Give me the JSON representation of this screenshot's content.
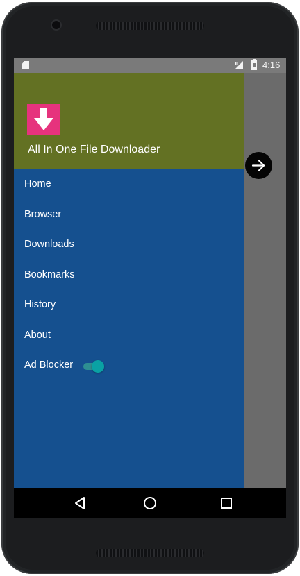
{
  "status_bar": {
    "time": "4:16",
    "icons": [
      "sd-card-icon",
      "signal-icon",
      "battery-icon"
    ]
  },
  "drawer": {
    "header": {
      "app_title": "All In One File Downloader",
      "logo_icon": "download-arrow-icon",
      "colors": {
        "header_bg": "#637123",
        "logo_bg": "#e6337d"
      }
    },
    "items": [
      {
        "label": "Home"
      },
      {
        "label": "Browser"
      },
      {
        "label": "Downloads"
      },
      {
        "label": "Bookmarks"
      },
      {
        "label": "History"
      },
      {
        "label": "About"
      },
      {
        "label": "Ad Blocker",
        "toggle_on": true
      }
    ],
    "colors": {
      "drawer_bg": "#15508f",
      "toggle_accent": "#0aa1a4"
    }
  },
  "floating": {
    "icon": "arrow-right-icon"
  },
  "nav_bar": {
    "icons": [
      "back-icon",
      "home-icon",
      "recents-icon"
    ]
  }
}
